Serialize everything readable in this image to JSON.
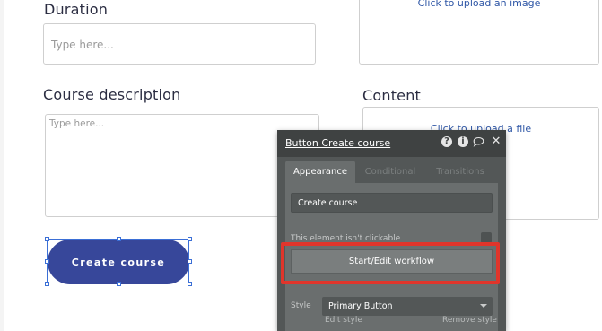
{
  "form": {
    "duration_label": "Duration",
    "duration_placeholder": "Type here...",
    "course_description_label": "Course description",
    "course_description_placeholder": "Type here...",
    "content_label": "Content",
    "upload_image_text": "Click to upload an image",
    "upload_file_text": "Click to upload a file",
    "create_button_label": "Create course"
  },
  "property_editor": {
    "title": "Button Create course",
    "icons": [
      "help-icon",
      "info-icon",
      "comment-icon",
      "close-icon"
    ],
    "tabs": [
      "Appearance",
      "Conditional",
      "Transitions"
    ],
    "active_tab": "Appearance",
    "button_text_value": "Create course",
    "not_clickable_text": "This element isn't clickable",
    "workflow_button_label": "Start/Edit workflow",
    "style_label": "Style",
    "style_value": "Primary Button",
    "edit_style_link": "Edit style",
    "remove_style_link": "Remove style"
  },
  "colors": {
    "primary_button": "#37479a",
    "highlight": "#e0352b",
    "panel_bg": "#535757",
    "panel_header": "#3f4242",
    "selection": "#3b6fd6"
  }
}
